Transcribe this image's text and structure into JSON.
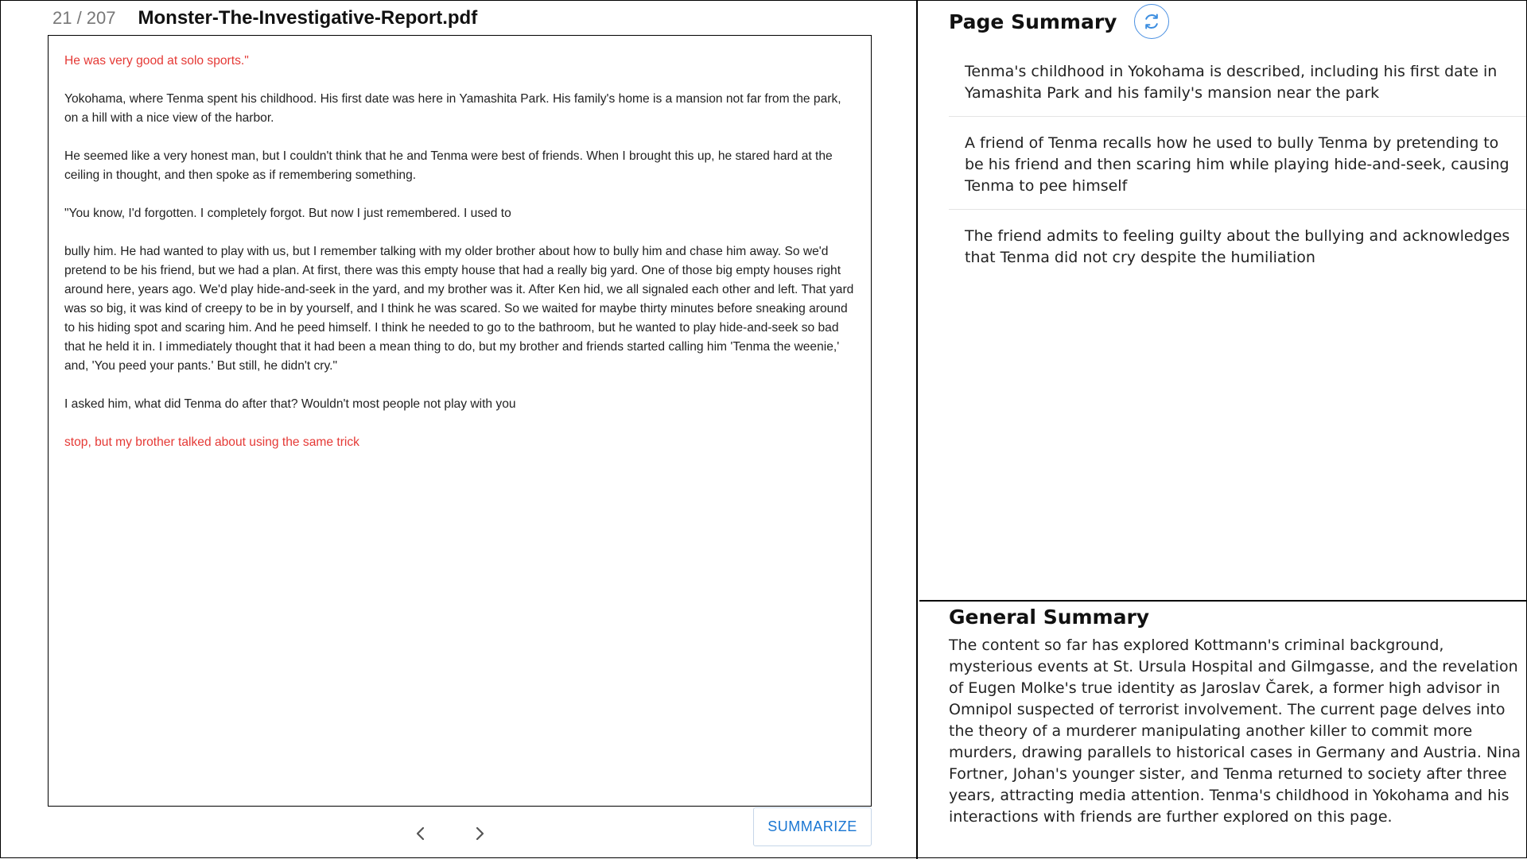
{
  "document": {
    "current_page": "21",
    "total_pages": "207",
    "page_counter": "21 / 207",
    "title": "Monster-The-Investigative-Report.pdf",
    "paragraphs": [
      {
        "text": "He was very good at solo sports.\"",
        "highlight": true
      },
      {
        "text": "Yokohama, where Tenma spent his childhood. His first date was here in Yamashita Park. His family's home is a mansion not far from the park, on a hill with a nice view of the harbor.",
        "highlight": false
      },
      {
        "text": "He seemed like a very honest man, but I couldn't think that he and Tenma were best of friends. When I brought this up, he stared hard at the ceiling in thought, and then spoke as if remembering something.",
        "highlight": false
      },
      {
        "text": "\"You know, I'd forgotten. I completely forgot. But now I just remembered. I used to",
        "highlight": false
      },
      {
        "text": "bully him. He had wanted to play with us, but I remember talking with my older brother about how to bully him and chase him away. So we'd pretend to be his friend, but we had a plan. At first, there was this empty house that had a really big yard. One of those big empty houses right around here, years ago. We'd play hide-and-seek in the yard, and my brother was it. After Ken hid, we all signaled each other and left. That yard was so big, it was kind of creepy to be in by yourself, and I think he was scared. So we waited for maybe thirty minutes before sneaking around to his hiding spot and scaring him. And he peed himself. I think he needed to go to the bathroom, but he wanted to play hide-and-seek so bad that he held it in. I immediately thought that it had been a mean thing to do, but my brother and friends started calling him 'Tenma the weenie,' and, 'You peed your pants.' But still, he didn't cry.\"",
        "highlight": false
      },
      {
        "text": "I asked him, what did Tenma do after that? Wouldn't most people not play with you",
        "highlight": false
      },
      {
        "text": "stop, but my brother talked about using the same trick",
        "highlight": true
      }
    ]
  },
  "controls": {
    "prev_icon": "chevron-left-icon",
    "next_icon": "chevron-right-icon",
    "summarize_label": "SUMMARIZE",
    "refresh_icon": "refresh-icon"
  },
  "page_summary": {
    "title": "Page Summary",
    "items": [
      "Tenma's childhood in Yokohama is described, including his first date in Yamashita Park and his family's mansion near the park",
      "A friend of Tenma recalls how he used to bully Tenma by pretending to be his friend and then scaring him while playing hide-and-seek, causing Tenma to pee himself",
      "The friend admits to feeling guilty about the bullying and acknowledges that Tenma did not cry despite the humiliation"
    ]
  },
  "general_summary": {
    "title": "General Summary",
    "text": "The content so far has explored Kottmann's criminal background, mysterious events at St. Ursula Hospital and Gilmgasse, and the revelation of Eugen Molke's true identity as Jaroslav Čarek, a former high advisor in Omnipol suspected of terrorist involvement. The current page delves into the theory of a murderer manipulating another killer to commit more murders, drawing parallels to historical cases in Germany and Austria. Nina Fortner, Johan's younger sister, and Tenma returned to society after three years, attracting media attention. Tenma's childhood in Yokohama and his interactions with friends are further explored on this page."
  },
  "colors": {
    "highlight_text": "#e53935",
    "accent": "#1976d2",
    "refresh_border": "#4a90e2"
  }
}
